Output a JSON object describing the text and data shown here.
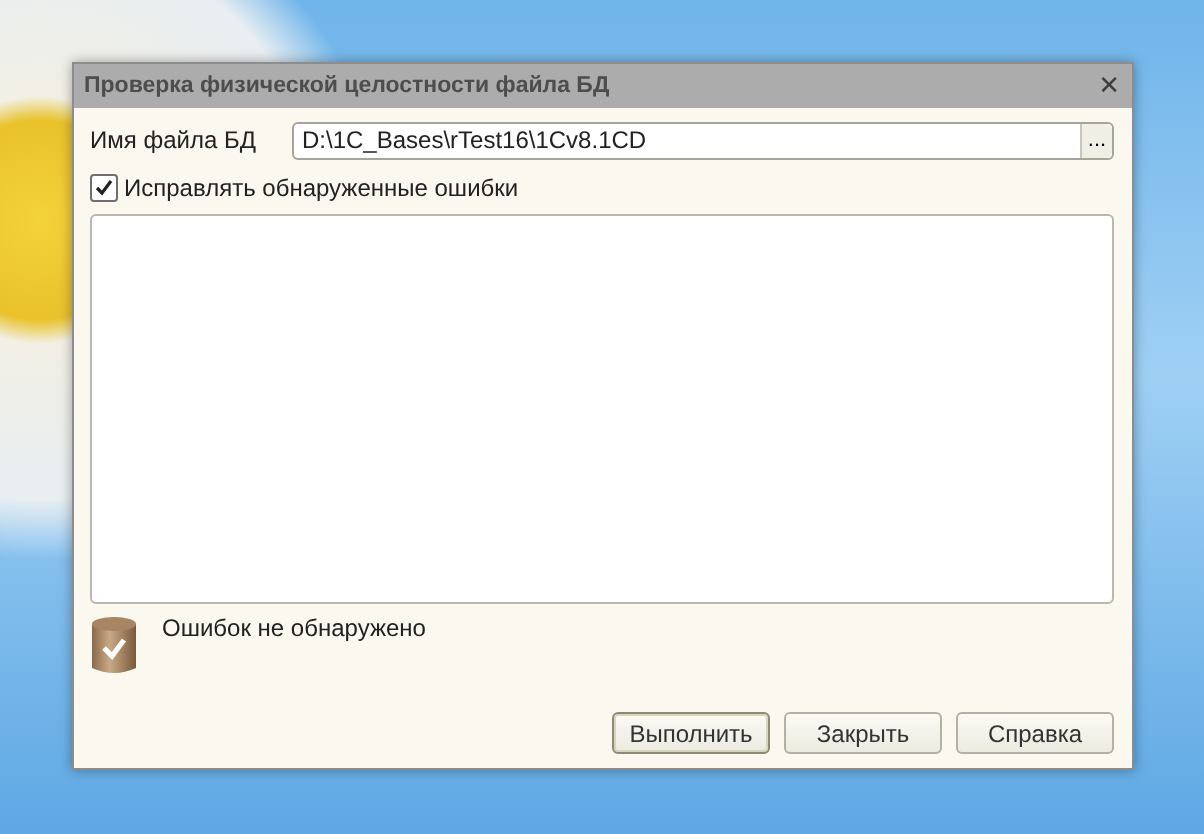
{
  "window": {
    "title": "Проверка физической целостности файла БД",
    "close": "✕"
  },
  "file_field": {
    "label": "Имя файла БД",
    "value": "D:\\1C_Bases\\rTest16\\1Cv8.1CD",
    "browse": "..."
  },
  "fix_errors": {
    "label": "Исправлять обнаруженные ошибки",
    "checked": true
  },
  "status": {
    "text": "Ошибок не обнаружено"
  },
  "buttons": [
    {
      "label": "Выполнить",
      "default": true
    },
    {
      "label": "Закрыть",
      "default": false
    },
    {
      "label": "Справка",
      "default": false
    }
  ]
}
